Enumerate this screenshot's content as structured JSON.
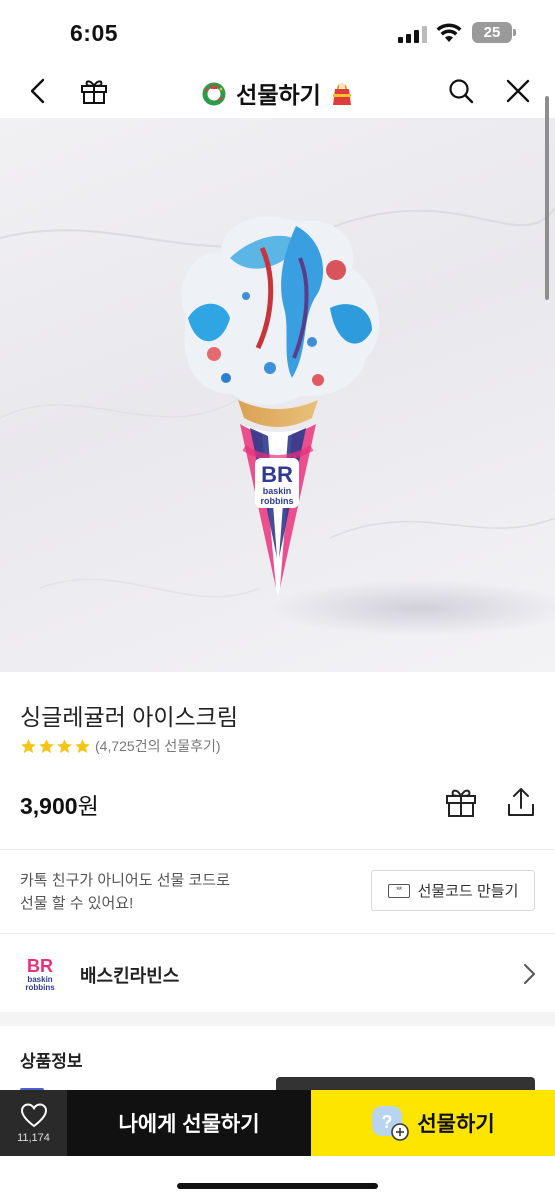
{
  "status_bar": {
    "time": "6:05",
    "battery": "25",
    "icons": [
      "signal-icon",
      "wifi-icon",
      "battery-icon"
    ]
  },
  "header": {
    "title": "선물하기",
    "left_icons": [
      "back-icon",
      "gift-box-icon"
    ],
    "right_icons": [
      "search-icon",
      "close-icon"
    ],
    "title_decorations": [
      "wreath-icon",
      "gift-bag-icon"
    ]
  },
  "hero": {
    "image": "ice-cream-cone-image",
    "cone_logo_text": [
      "BR",
      "baskin",
      "robbins"
    ]
  },
  "product": {
    "name": "싱글레귤러 아이스크림",
    "rating_stars": 4,
    "review_text": "(4,725건의 선물후기)",
    "price_value": "3,900",
    "price_unit": "원"
  },
  "gift_code": {
    "description_line1": "카톡 친구가 아니어도 선물 코드로",
    "description_line2": "선물 할 수 있어요!",
    "button_label": "선물코드 만들기",
    "button_icon_text": "**"
  },
  "brand": {
    "name": "배스킨라빈스",
    "logo_text": [
      "BR",
      "baskin",
      "robbins"
    ]
  },
  "section": {
    "title": "상품정보"
  },
  "bottom_bar": {
    "like_count": "11,174",
    "self_gift_label": "나에게 선물하기",
    "gift_label": "선물하기"
  },
  "colors": {
    "kakao_yellow": "#fee500",
    "star_yellow": "#f5c518",
    "br_pink": "#e8307a",
    "br_blue": "#2e3b8f",
    "dark_bar": "#111111"
  }
}
